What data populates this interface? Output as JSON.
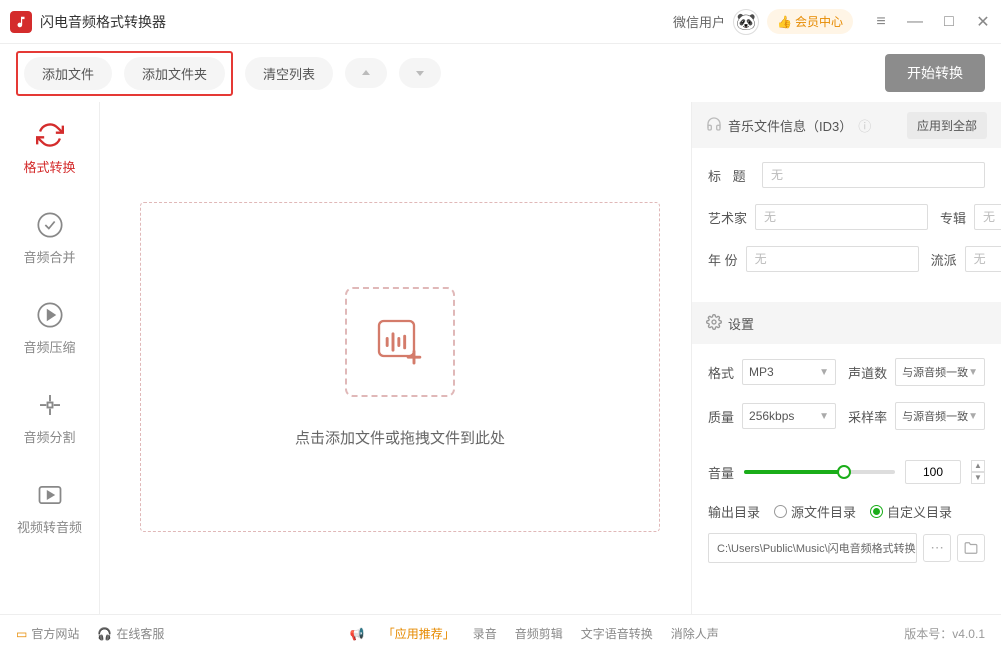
{
  "titlebar": {
    "app_name": "闪电音频格式转换器",
    "user_label": "微信用户",
    "vip_label": "会员中心"
  },
  "toolbar": {
    "add_file": "添加文件",
    "add_folder": "添加文件夹",
    "clear_list": "清空列表",
    "start": "开始转换"
  },
  "sidebar": {
    "items": [
      {
        "label": "格式转换"
      },
      {
        "label": "音频合并"
      },
      {
        "label": "音频压缩"
      },
      {
        "label": "音频分割"
      },
      {
        "label": "视频转音频"
      }
    ]
  },
  "dropzone": {
    "text": "点击添加文件或拖拽文件到此处"
  },
  "id3": {
    "header": "音乐文件信息（ID3）",
    "apply_all": "应用到全部",
    "title_label": "标 题",
    "title_ph": "无",
    "artist_label": "艺术家",
    "artist_ph": "无",
    "album_label": "专辑",
    "album_ph": "无",
    "year_label": "年 份",
    "year_ph": "无",
    "genre_label": "流派",
    "genre_ph": "无"
  },
  "settings": {
    "header": "设置",
    "format_label": "格式",
    "format_value": "MP3",
    "channels_label": "声道数",
    "channels_value": "与源音频一致",
    "quality_label": "质量",
    "quality_value": "256kbps",
    "samplerate_label": "采样率",
    "samplerate_value": "与源音频一致",
    "volume_label": "音量",
    "volume_value": "100",
    "output_label": "输出目录",
    "radio_source": "源文件目录",
    "radio_custom": "自定义目录",
    "output_path": "C:\\Users\\Public\\Music\\闪电音频格式转换器"
  },
  "footer": {
    "official": "官方网站",
    "support": "在线客服",
    "recommend": "「应用推荐」",
    "links": [
      "录音",
      "音频剪辑",
      "文字语音转换",
      "消除人声"
    ],
    "version_label": "版本号：",
    "version": "v4.0.1"
  }
}
